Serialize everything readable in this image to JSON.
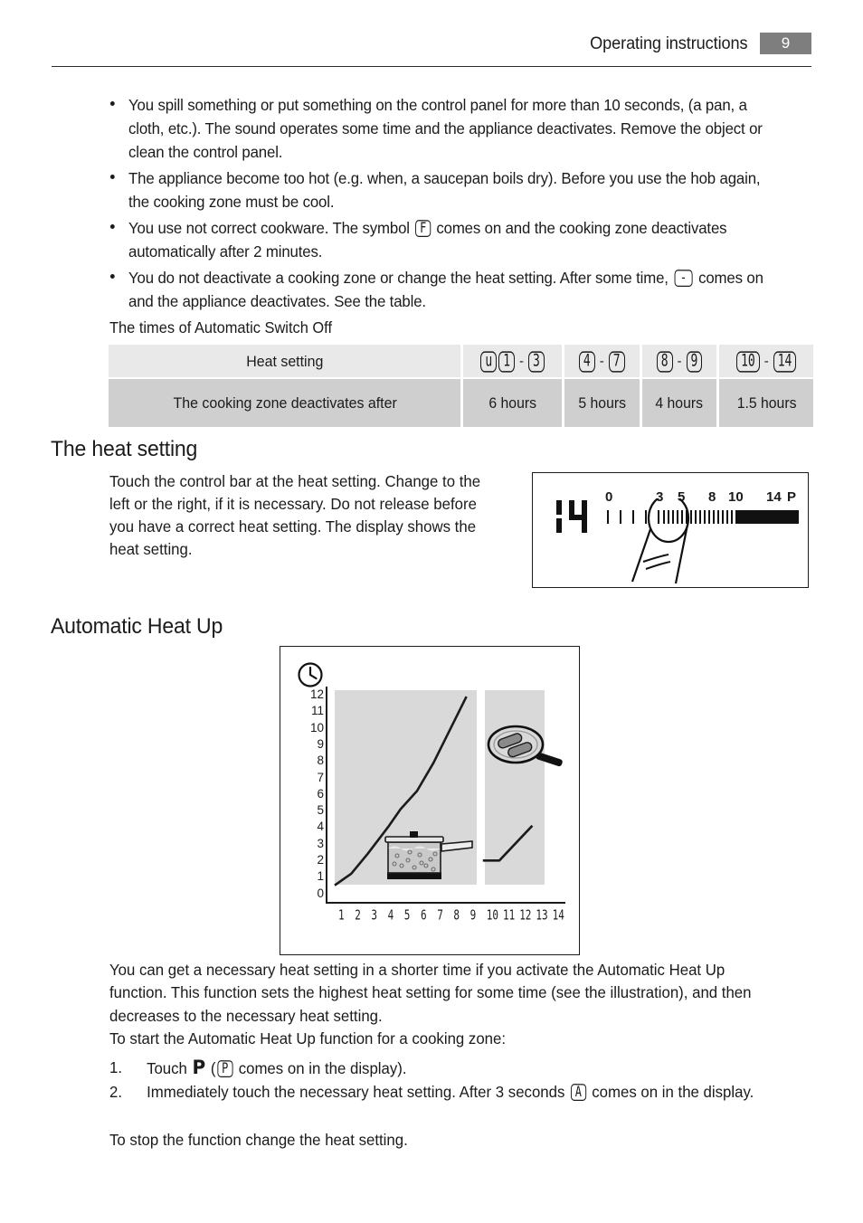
{
  "header": {
    "title": "Operating instructions",
    "page_number": "9"
  },
  "bullets": [
    {
      "id": "spill",
      "parts": [
        {
          "type": "text",
          "value": "You spill something or put something on the control panel for more than 10 seconds, (a pan, a cloth, etc.). The sound operates some time and the appliance deactivates. Remove the object or clean the control panel."
        }
      ]
    },
    {
      "id": "too-hot",
      "parts": [
        {
          "type": "text",
          "value": "The appliance become too hot (e.g. when, a saucepan boils dry). Before you use the hob again, the cooking zone must be cool."
        }
      ]
    },
    {
      "id": "wrong-cookware",
      "parts": [
        {
          "type": "text",
          "value": "You use not correct cookware. The symbol "
        },
        {
          "type": "lcd",
          "value": "F"
        },
        {
          "type": "text",
          "value": " comes on and the cooking zone deactivates automatically after 2 minutes."
        }
      ]
    },
    {
      "id": "no-change",
      "parts": [
        {
          "type": "text",
          "value": "You do not deactivate a cooking zone or change the heat setting. After some time, "
        },
        {
          "type": "lcd",
          "value": "-"
        },
        {
          "type": "text",
          "value": " comes on and the appliance deactivates. See the table."
        }
      ]
    }
  ],
  "table": {
    "caption": "The times of Automatic Switch Off",
    "row_labels": {
      "heat_setting": "Heat setting",
      "deactivates_after": "The cooking zone deactivates after"
    },
    "columns": [
      {
        "symbols": [
          "u",
          "1",
          "-",
          "3"
        ],
        "time": "6 hours"
      },
      {
        "symbols": [
          "4",
          "-",
          "7"
        ],
        "time": "5 hours"
      },
      {
        "symbols": [
          "8",
          "-",
          "9"
        ],
        "time": "4 hours"
      },
      {
        "symbols": [
          "10",
          "-",
          "14"
        ],
        "time": "1.5 hours"
      }
    ]
  },
  "heat_setting_section": {
    "heading": "The heat setting",
    "body": "Touch the control bar at the heat setting. Change to the left or the right, if it is necessary. Do not release before you have a correct heat setting. The display shows the heat setting.",
    "figure": {
      "display_value": "14",
      "bar_labels": [
        "0",
        "3",
        "5",
        "8",
        "10",
        "14",
        "P"
      ],
      "icons": [
        "finger-touch",
        "control-slider-bar",
        "lcd-display"
      ]
    }
  },
  "auto_heat_section": {
    "heading": "Automatic Heat Up",
    "paragraph_1": "You can get a necessary heat setting in a shorter time if you activate the Automatic Heat Up function. This function sets the highest heat setting for some time (see the illustration), and then decreases to the necessary heat setting.",
    "paragraph_2": "To start the Automatic Heat Up function for a cooking zone:",
    "steps": [
      {
        "number": "1.",
        "parts": [
          {
            "type": "text",
            "value": "Touch "
          },
          {
            "type": "pglyph",
            "value": "P"
          },
          {
            "type": "text",
            "value": " ("
          },
          {
            "type": "lcd",
            "value": "P"
          },
          {
            "type": "text",
            "value": " comes on in the display)."
          }
        ]
      },
      {
        "number": "2.",
        "parts": [
          {
            "type": "text",
            "value": "Immediately touch the necessary heat setting. After 3 seconds "
          },
          {
            "type": "lcd",
            "value": "A"
          },
          {
            "type": "text",
            "value": " comes on in the display."
          }
        ]
      }
    ],
    "closing": "To stop the function change the heat setting."
  },
  "chart_data": {
    "type": "line",
    "title": "Automatic Heat Up",
    "xlabel": "",
    "ylabel": "",
    "icons": [
      "clock-icon",
      "boiling-pot",
      "frying-pan"
    ],
    "x_tick_labels": [
      "1",
      "2",
      "3",
      "4",
      "5",
      "6",
      "7",
      "8",
      "9",
      "10",
      "11",
      "12",
      "13",
      "14"
    ],
    "y_tick_labels": [
      "12",
      "11",
      "10",
      "9",
      "8",
      "7",
      "6",
      "5",
      "4",
      "3",
      "2",
      "1",
      "0"
    ],
    "xlim": [
      0,
      14
    ],
    "ylim": [
      0,
      12
    ],
    "grid": false,
    "series": [
      {
        "name": "heat-up-curve",
        "x": [
          1,
          2,
          3,
          4,
          4.3,
          5,
          6,
          7,
          8,
          9
        ],
        "y": [
          1.0,
          1.7,
          2.9,
          4.2,
          4.6,
          5.6,
          6.7,
          8.4,
          10.4,
          12.4
        ]
      },
      {
        "name": "second-zone-curve",
        "x": [
          10,
          11,
          13
        ],
        "y": [
          2.5,
          2.5,
          4.6
        ]
      }
    ]
  },
  "colors": {
    "page_badge": "#7e7e7e",
    "table_head": "#e9e9e9",
    "table_body": "#cfcfcf",
    "panel_gray": "#d9d9d9",
    "ink": "#1b1b1b"
  }
}
